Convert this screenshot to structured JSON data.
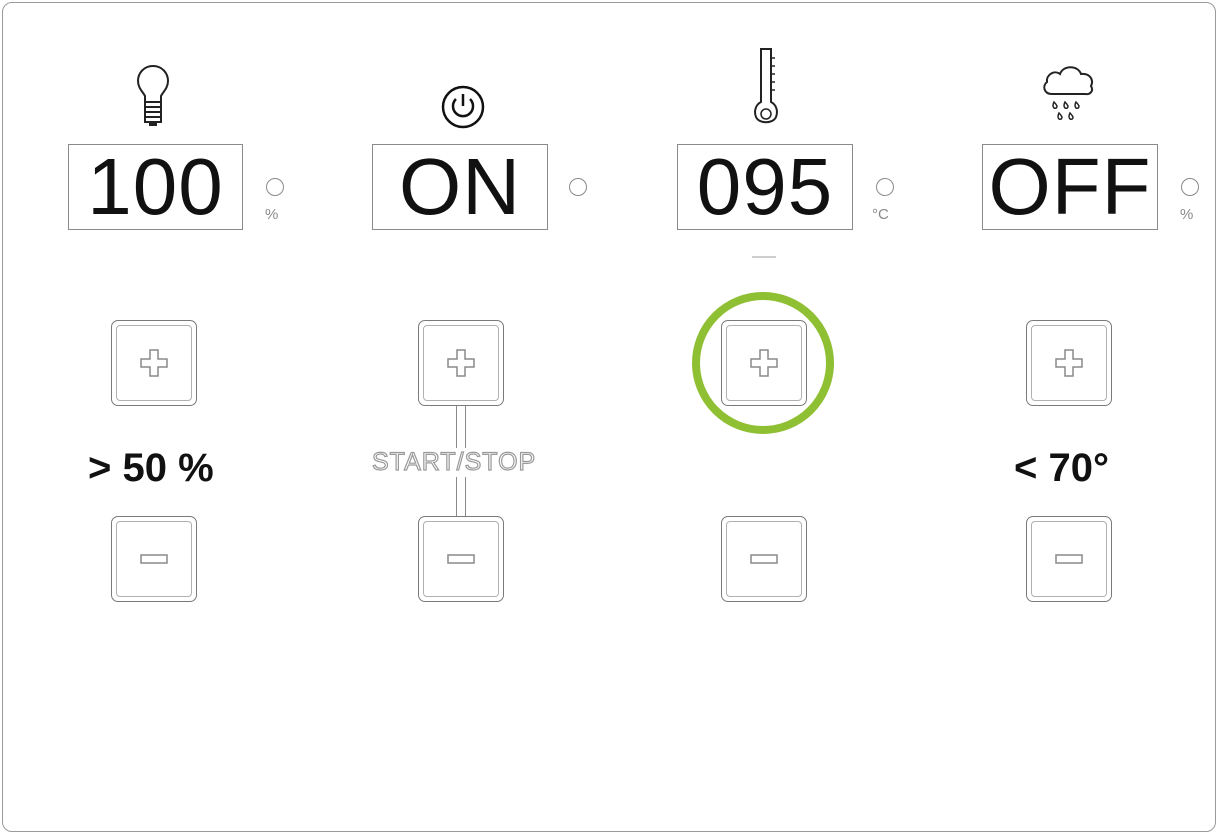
{
  "channels": [
    {
      "icon": "light-bulb-icon",
      "value": "100",
      "unit": "%"
    },
    {
      "icon": "power-icon",
      "value": "ON",
      "unit": ""
    },
    {
      "icon": "thermometer-icon",
      "value": "095",
      "unit": "°C"
    },
    {
      "icon": "rain-cloud-icon",
      "value": "OFF",
      "unit": "%"
    }
  ],
  "labels": {
    "light_threshold": "> 50 %",
    "start_stop": "START/STOP",
    "rain_threshold": "< 70°"
  },
  "colors": {
    "highlight": "#8fbf32",
    "outline": "#8a8a8a"
  }
}
